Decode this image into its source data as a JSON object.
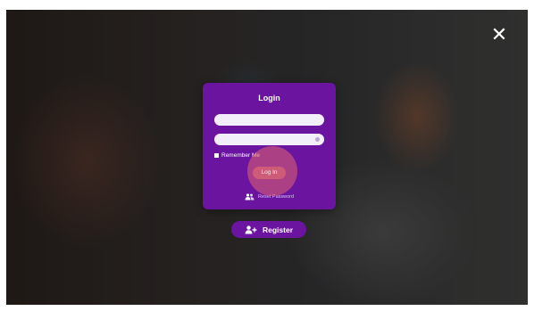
{
  "overlay": {
    "close_label": "✕"
  },
  "login": {
    "title": "Login",
    "username_value": "",
    "password_value": "",
    "remember_label": "Remember Me",
    "login_button": "Log In",
    "reset_label": "Reset Password"
  },
  "register": {
    "label": "Register"
  },
  "icons": {
    "close": "close-icon",
    "eye": "eye-icon",
    "reset": "users-icon",
    "register": "user-plus-icon"
  },
  "colors": {
    "card": "#6a14a0",
    "login_button": "#d25f78",
    "input": "#f2eefa"
  }
}
